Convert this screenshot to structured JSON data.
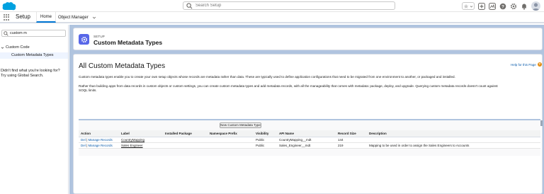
{
  "global_header": {
    "search_placeholder": "Search Setup",
    "brand_color": "#00a1e0"
  },
  "context_bar": {
    "app_name": "Setup",
    "tabs": [
      {
        "label": "Home",
        "active": true
      },
      {
        "label": "Object Manager",
        "active": false
      }
    ]
  },
  "sidebar": {
    "quick_find_value": "custom m",
    "tree_parent": "Custom Code",
    "tree_child": "Custom Metadata Types",
    "not_found_line1": "Didn't find what you're looking for?",
    "not_found_line2": "Try using Global Search."
  },
  "page_header": {
    "eyebrow": "SETUP",
    "title": "Custom Metadata Types",
    "icon": "gear-icon"
  },
  "content": {
    "title": "All Custom Metadata Types",
    "help_link": "Help for this Page",
    "description_1": "Custom metadata types enable you to create your own setup objects whose records are metadata rather than data. These are typically used to define application configurations that need to be migrated from one environment to another, or packaged and installed.",
    "description_2a": "Rather than building apps from data records in custom objects or custom settings, you can create custom metadata types and add metadata records, with all the manageability that comes with metadata: package, deploy, and upgrade. Querying custom metadata records doesn't count against",
    "description_2b": "SOQL limits.",
    "new_button": "New Custom Metadata Type"
  },
  "table": {
    "headers": [
      "Action",
      "Label",
      "Installed Package",
      "Namespace Prefix",
      "Visibility",
      "API Name",
      "Record Size",
      "Description"
    ],
    "rows": [
      {
        "action_del": "Del",
        "action_sep": " | ",
        "action_manage": "Manage Records",
        "label": "CountryMapping",
        "installed_package": "",
        "namespace_prefix": "",
        "visibility": "Public",
        "api_name": "CountryMapping__mdt",
        "record_size": "144",
        "description": ""
      },
      {
        "action_del": "Del",
        "action_sep": " | ",
        "action_manage": "Manage Records",
        "label": "Sales Engineer",
        "installed_package": "",
        "namespace_prefix": "",
        "visibility": "Public",
        "api_name": "Sales_Engineer__mdt",
        "record_size": "219",
        "description": "Mapping to be used in order to assign the Sales Engineers to Accounts"
      }
    ]
  }
}
